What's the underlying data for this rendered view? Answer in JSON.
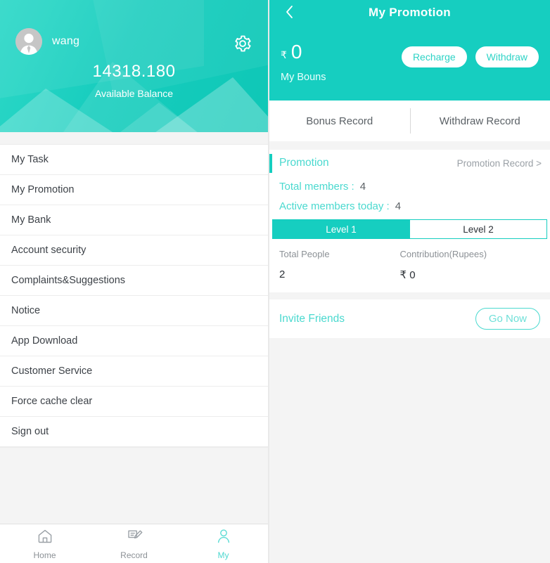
{
  "left": {
    "profile": {
      "avatar_icon": "user-avatar-icon",
      "user_name": "wang",
      "settings_icon": "gear-icon",
      "balance_amount": "14318.180",
      "balance_label": "Available Balance"
    },
    "menu": {
      "items": [
        {
          "label": "My Task"
        },
        {
          "label": "My Promotion"
        },
        {
          "label": "My Bank"
        },
        {
          "label": "Account security"
        },
        {
          "label": "Complaints&Suggestions"
        },
        {
          "label": "Notice"
        },
        {
          "label": "App Download"
        },
        {
          "label": "Customer Service"
        },
        {
          "label": "Force cache clear"
        },
        {
          "label": "Sign out"
        }
      ]
    },
    "tabbar": {
      "items": [
        {
          "label": "Home",
          "icon": "home-icon",
          "active": false
        },
        {
          "label": "Record",
          "icon": "record-icon",
          "active": false
        },
        {
          "label": "My",
          "icon": "person-icon",
          "active": true
        }
      ]
    }
  },
  "right": {
    "header": {
      "back_icon": "back-chevron-icon",
      "title": "My Promotion",
      "currency_symbol": "₹",
      "bonus_amount": "0",
      "bonus_label": "My Bouns",
      "recharge_label": "Recharge",
      "withdraw_label": "Withdraw"
    },
    "record_tabs": [
      {
        "label": "Bonus Record"
      },
      {
        "label": "Withdraw Record"
      }
    ],
    "promotion": {
      "section_title": "Promotion",
      "record_link": "Promotion Record >",
      "total_members_label": "Total members :",
      "total_members_value": "4",
      "active_members_label": "Active members today :",
      "active_members_value": "4",
      "level_tabs": [
        {
          "label": "Level 1",
          "active": true
        },
        {
          "label": "Level 2",
          "active": false
        }
      ],
      "stats": {
        "headers": [
          "Total People",
          "Contribution(Rupees)"
        ],
        "values": [
          "2",
          "₹ 0"
        ]
      }
    },
    "invite": {
      "title": "Invite Friends",
      "button_label": "Go Now"
    }
  },
  "colors": {
    "accent_teal": "#16cec0",
    "accent_teal_light": "#4ad9cf",
    "page_bg": "#f4f4f4",
    "text_dark": "#3d4248",
    "text_muted": "#8c9196"
  }
}
